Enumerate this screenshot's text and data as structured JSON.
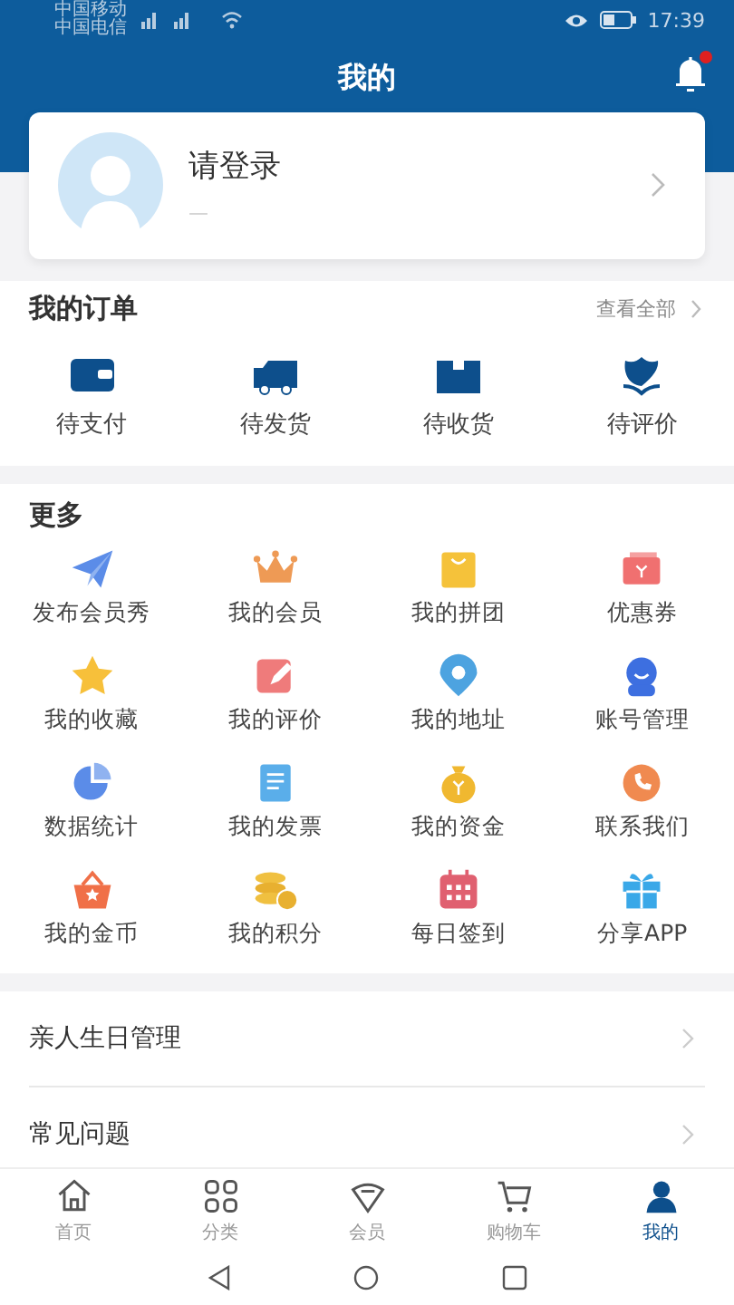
{
  "status_bar": {
    "carriers": [
      "中国移动",
      "中国电信"
    ],
    "time": "17:39"
  },
  "header": {
    "title": "我的",
    "unread": true
  },
  "profile": {
    "name": "请登录",
    "subtitle": "—"
  },
  "orders": {
    "title": "我的订单",
    "view_all": "查看全部",
    "items": [
      {
        "label": "待支付"
      },
      {
        "label": "待发货"
      },
      {
        "label": "待收货"
      },
      {
        "label": "待评价"
      }
    ]
  },
  "more": {
    "title": "更多",
    "items": [
      {
        "label": "发布会员秀"
      },
      {
        "label": "我的会员"
      },
      {
        "label": "我的拼团"
      },
      {
        "label": "优惠券"
      },
      {
        "label": "我的收藏"
      },
      {
        "label": "我的评价"
      },
      {
        "label": "我的地址"
      },
      {
        "label": "账号管理"
      },
      {
        "label": "数据统计"
      },
      {
        "label": "我的发票"
      },
      {
        "label": "我的资金"
      },
      {
        "label": "联系我们"
      },
      {
        "label": "我的金币"
      },
      {
        "label": "我的积分"
      },
      {
        "label": "每日签到"
      },
      {
        "label": "分享APP"
      }
    ]
  },
  "menu": [
    {
      "label": "亲人生日管理"
    },
    {
      "label": "常见问题"
    }
  ],
  "tab_bar": [
    {
      "label": "首页",
      "selected": false
    },
    {
      "label": "分类",
      "selected": false
    },
    {
      "label": "会员",
      "selected": false
    },
    {
      "label": "购物车",
      "selected": false
    },
    {
      "label": "我的",
      "selected": true
    }
  ]
}
